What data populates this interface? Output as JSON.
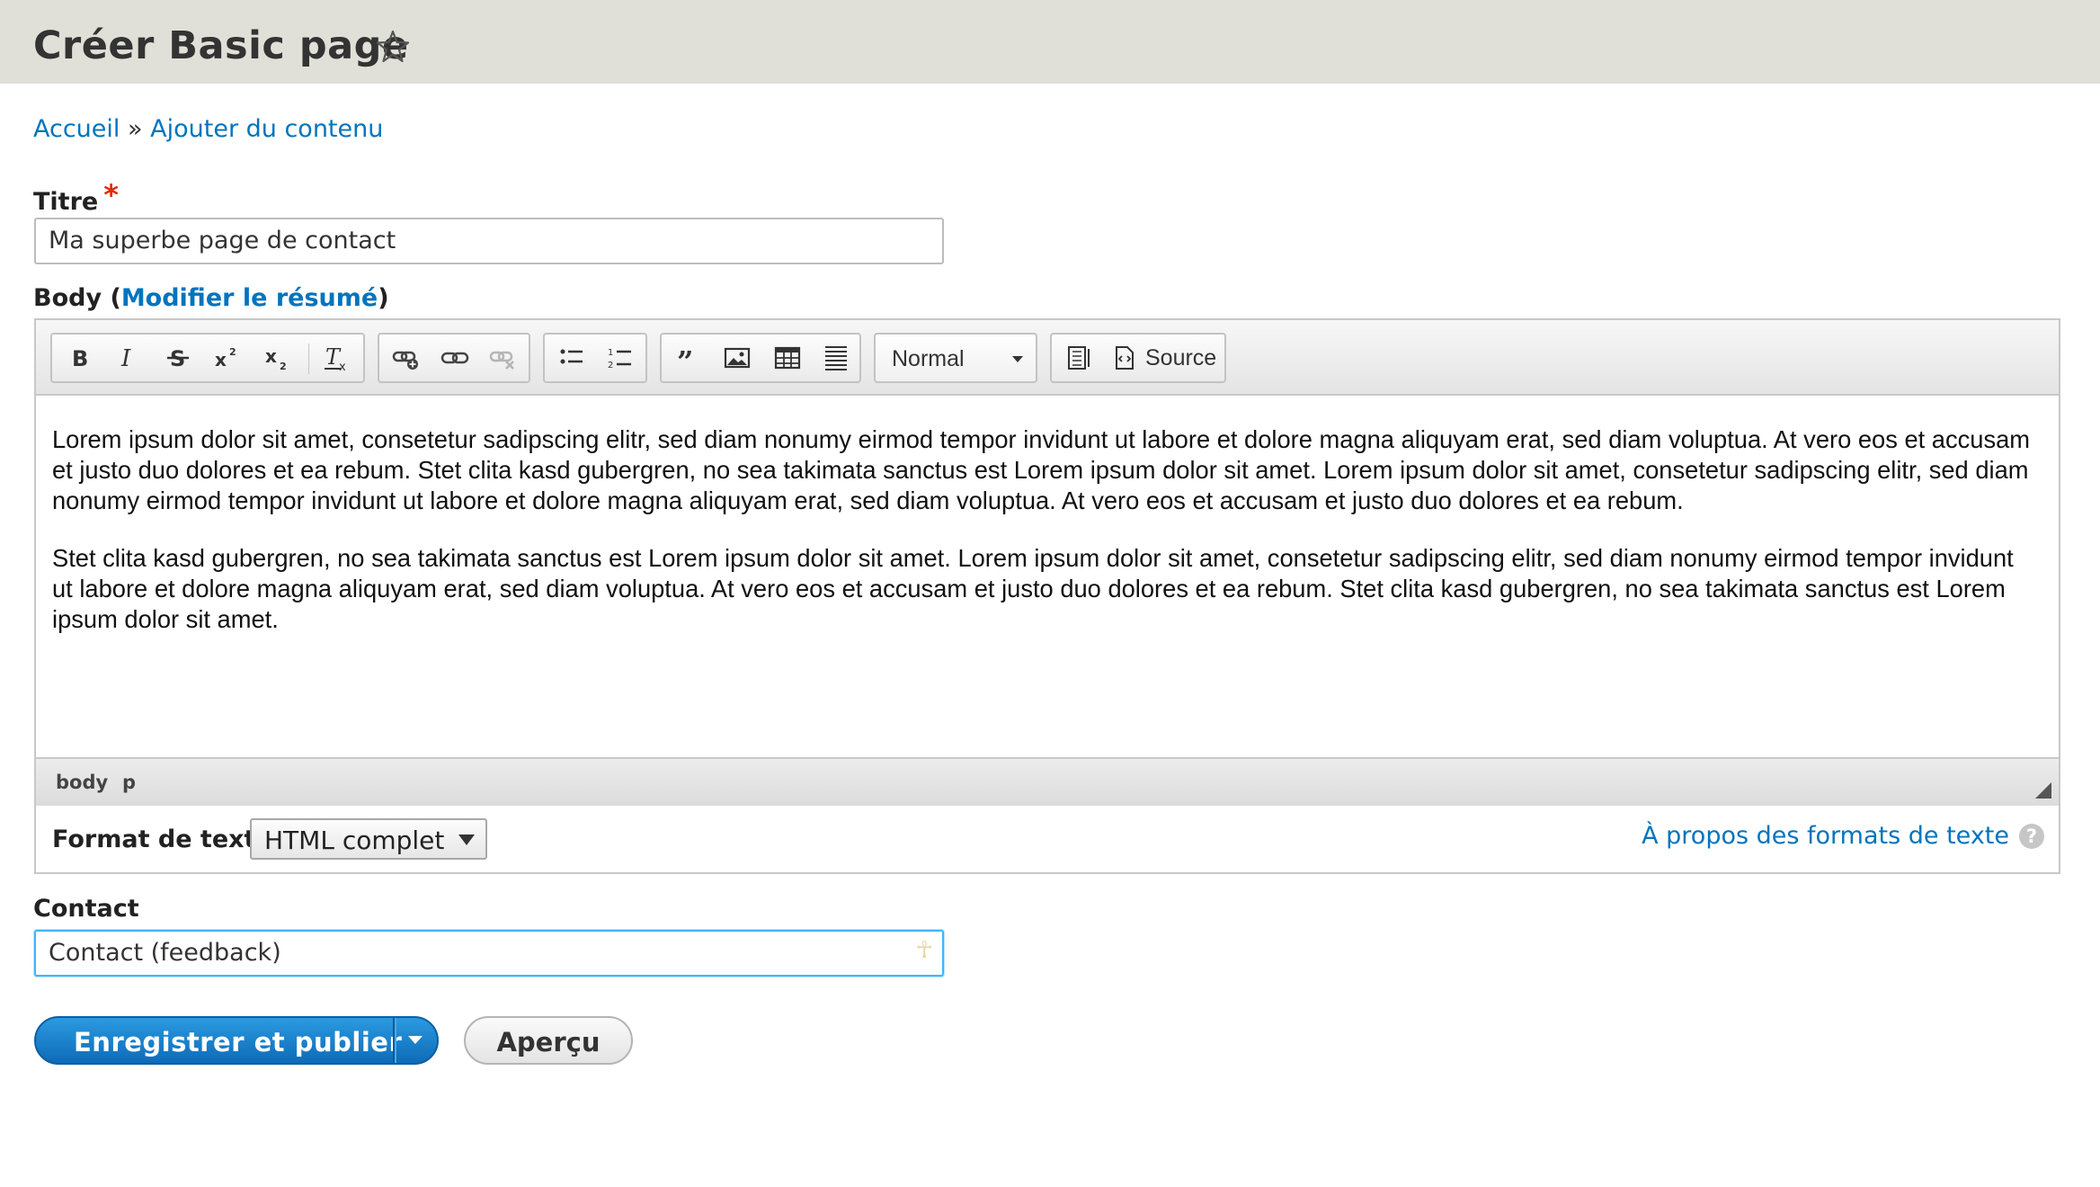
{
  "page": {
    "title": "Créer Basic page"
  },
  "breadcrumb": {
    "home": "Accueil",
    "separator": "»",
    "add_content": "Ajouter du contenu"
  },
  "title_field": {
    "label": "Titre",
    "required_marker": "*",
    "value": "Ma superbe page de contact"
  },
  "body_field": {
    "label": "Body",
    "open_paren": "(",
    "summary_link": "Modifier le résumé",
    "close_paren": ")"
  },
  "editor": {
    "toolbar": {
      "format_combo": "Normal",
      "source_label": "Source",
      "icons": [
        "bold-icon",
        "italic-icon",
        "strikethrough-icon",
        "superscript-icon",
        "subscript-icon",
        "remove-format-icon",
        "link-add-icon",
        "link-icon",
        "unlink-icon",
        "bulleted-list-icon",
        "numbered-list-icon",
        "blockquote-icon",
        "image-icon",
        "table-icon",
        "horizontal-line-icon",
        "show-blocks-icon",
        "source-icon"
      ]
    },
    "paragraphs": [
      "Lorem ipsum dolor sit amet, consetetur sadipscing elitr, sed diam nonumy eirmod tempor invidunt ut labore et dolore magna aliquyam erat, sed diam voluptua. At vero eos et accusam et justo duo dolores et ea rebum. Stet clita kasd gubergren, no sea takimata sanctus est Lorem ipsum dolor sit amet. Lorem ipsum dolor sit amet, consetetur sadipscing elitr, sed diam nonumy eirmod tempor invidunt ut labore et dolore magna aliquyam erat, sed diam voluptua. At vero eos et accusam et justo duo dolores et ea rebum.",
      "Stet clita kasd gubergren, no sea takimata sanctus est Lorem ipsum dolor sit amet. Lorem ipsum dolor sit amet, consetetur sadipscing elitr, sed diam nonumy eirmod tempor invidunt ut labore et dolore magna aliquyam erat, sed diam voluptua. At vero eos et accusam et justo duo dolores et ea rebum. Stet clita kasd gubergren, no sea takimata sanctus est Lorem ipsum dolor sit amet."
    ],
    "path": [
      "body",
      "p"
    ]
  },
  "text_format": {
    "label": "Format de texte",
    "selected": "HTML complet",
    "help_link": "À propos des formats de texte",
    "help_icon": "?"
  },
  "contact_field": {
    "label": "Contact",
    "value": "Contact (feedback)"
  },
  "actions": {
    "save_publish": "Enregistrer et publier",
    "preview": "Aperçu"
  },
  "colors": {
    "header_bg": "#e0e0d8",
    "link": "#0074bd",
    "primary_button": "#1f86d0",
    "required": "#e62600",
    "focus_border": "#40b6ff"
  }
}
